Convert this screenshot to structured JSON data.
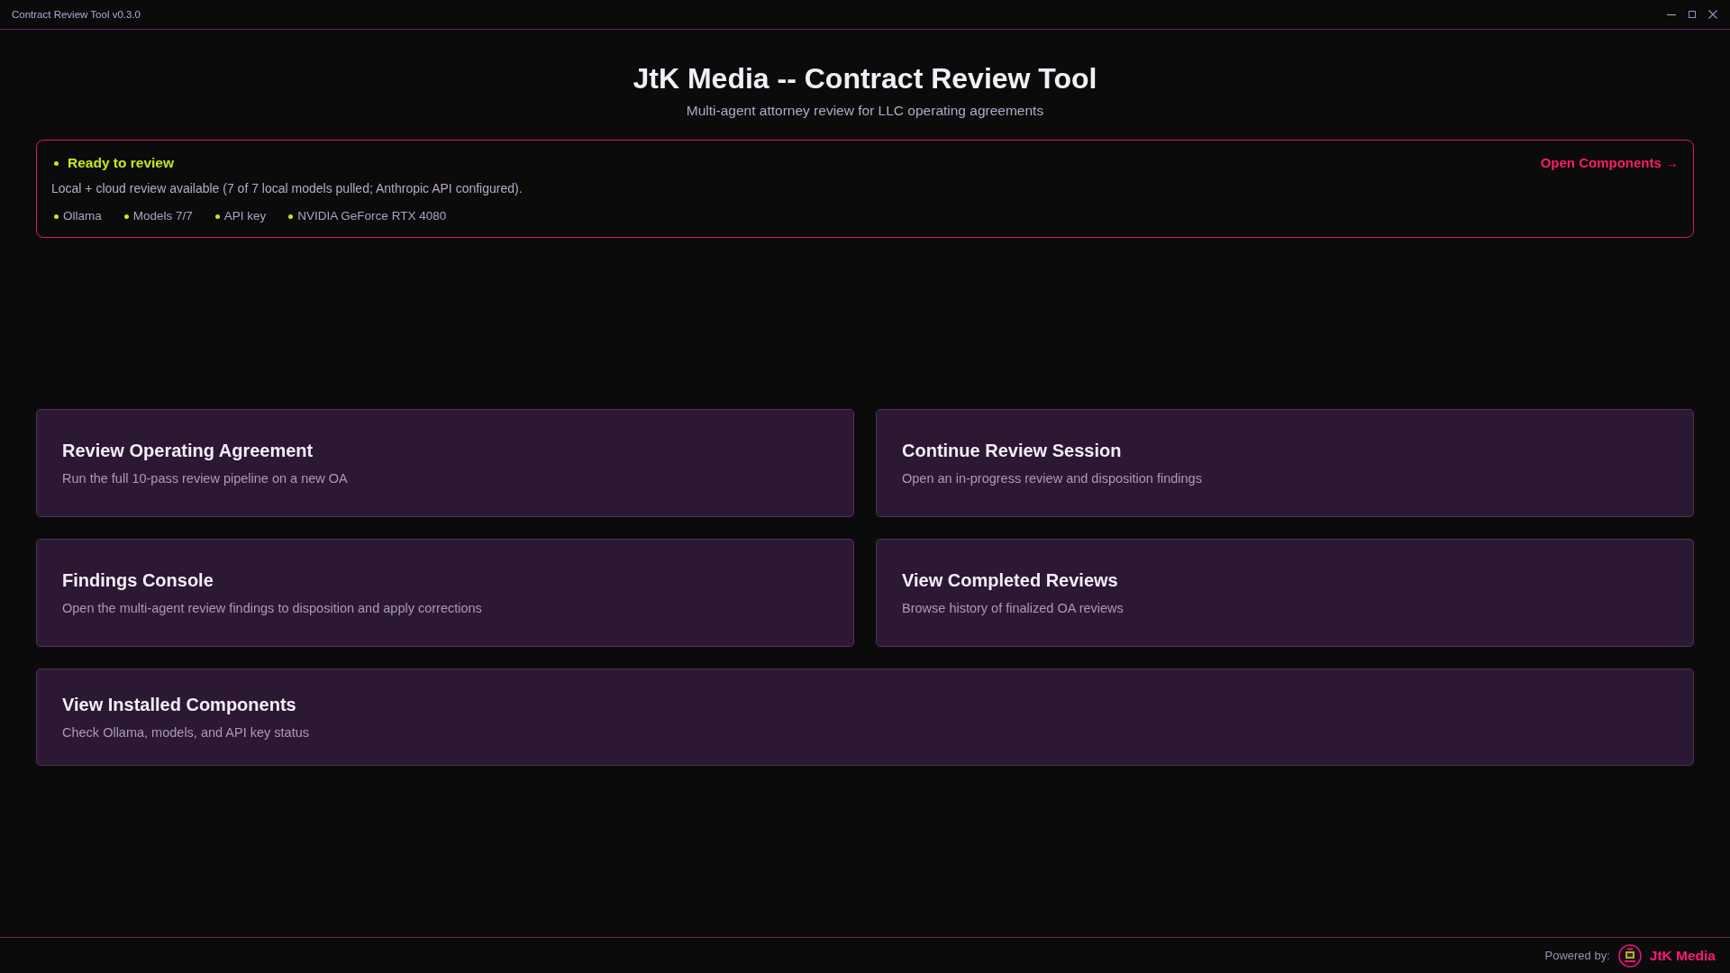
{
  "window": {
    "title": "Contract Review Tool v0.3.0"
  },
  "header": {
    "title": "JtK Media -- Contract Review Tool",
    "subtitle": "Multi-agent attorney review for LLC operating agreements"
  },
  "status": {
    "ok": true,
    "headline": "Ready to review",
    "message": "Local + cloud review available (7 of 7 local models pulled; Anthropic API configured).",
    "link": "Open Components →",
    "checks": [
      {
        "label": "Ollama",
        "ok": true
      },
      {
        "label": "Models 7/7",
        "ok": true
      },
      {
        "label": "API key",
        "ok": true
      },
      {
        "label": "NVIDIA GeForce RTX 4080",
        "ok": true
      }
    ]
  },
  "actions": [
    {
      "kind": "half",
      "title": "Review Operating Agreement",
      "description": "Run the full 10-pass review pipeline on a new OA"
    },
    {
      "kind": "half",
      "title": "Continue Review Session",
      "description": "Open an in-progress review and disposition findings"
    },
    {
      "kind": "half",
      "title": "Findings Console",
      "description": "Open the multi-agent review findings to disposition and apply corrections"
    },
    {
      "kind": "half",
      "title": "View Completed Reviews",
      "description": "Browse history of finalized OA reviews"
    },
    {
      "kind": "full",
      "title": "View Installed Components",
      "description": "Check Ollama, models, and API key status"
    }
  ],
  "footer": {
    "label": "Powered by:",
    "brand": "JtK Media"
  }
}
